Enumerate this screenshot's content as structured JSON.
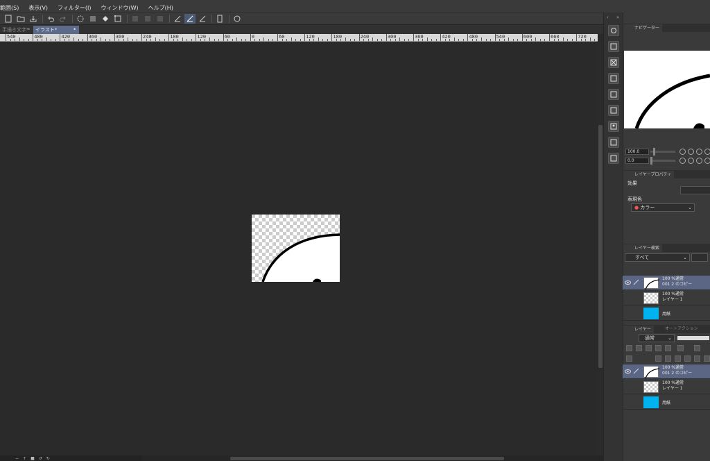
{
  "menu": {
    "items": [
      "範囲(S)",
      "表示(V)",
      "フィルター(I)",
      "ウィンドウ(W)",
      "ヘルプ(H)"
    ]
  },
  "tabs": [
    {
      "label": "手描き文字*",
      "active": false
    },
    {
      "label": "イラスト*",
      "active": true
    }
  ],
  "ruler": {
    "labels": [
      "540",
      "480",
      "420",
      "360",
      "300",
      "240",
      "180",
      "120",
      "60",
      "0",
      "60",
      "120",
      "180",
      "240",
      "300",
      "360",
      "420",
      "480",
      "540",
      "600",
      "660",
      "720"
    ]
  },
  "navigator": {
    "tabs": [
      "ナビゲーター"
    ],
    "zoom_value": "100.0",
    "rotate_value": "0.0"
  },
  "layer_property": {
    "tab": "レイヤープロパティ",
    "effect_label": "効果",
    "expression_color_label": "表現色",
    "expression_color_value": "カラー"
  },
  "layer_search": {
    "tab": "レイヤー検索",
    "filter_value": "すべて",
    "rows": [
      {
        "line1": "100 %通常",
        "line2": "001 2 のコピー",
        "selected": true,
        "thumb": "sketch"
      },
      {
        "line1": "100 %通常",
        "line2": "レイヤー 1",
        "selected": false,
        "thumb": "checker"
      },
      {
        "line1": "",
        "line2": "用紙",
        "selected": false,
        "thumb": "blue"
      }
    ]
  },
  "layers": {
    "tab": "レイヤー",
    "tab2": "オートアクション",
    "blend_mode": "通常",
    "rows": [
      {
        "line1": "100 %通常",
        "line2": "001 2 のコピー",
        "selected": true,
        "thumb": "sketch"
      },
      {
        "line1": "100 %通常",
        "line2": "レイヤー 1",
        "selected": false,
        "thumb": "checker"
      },
      {
        "line1": "",
        "line2": "用紙",
        "selected": false,
        "thumb": "blue"
      }
    ]
  },
  "colors": {
    "accent": "#5d6a8a",
    "paper_blue": "#00b2f0",
    "background": "#2a2a2a"
  }
}
